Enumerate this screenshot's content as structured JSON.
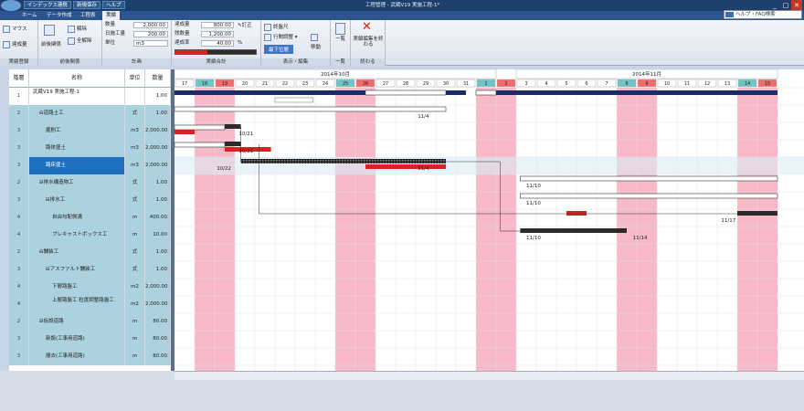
{
  "titlebar": {
    "app_menu": "インデックス連携",
    "quick1": "新規保存",
    "quick2": "ヘルプ",
    "title": "工程管理 - 武蔵V19 実施工程-1*"
  },
  "tabs": [
    "ホーム",
    "データ作成",
    "工程表",
    "実績"
  ],
  "active_tab": "実績",
  "help": {
    "placeholder": "ヘルプ・FAQ検索"
  },
  "ribbon": {
    "g1": {
      "label": "実績登録",
      "mouse": "マウス",
      "input": "達成量"
    },
    "g2": {
      "label": "前後関係",
      "before_after": "前後関係",
      "release": "解除",
      "all_release": "全解除"
    },
    "g3": {
      "label": "計画",
      "qty_label": "数量",
      "qty": "2,000.00",
      "cost_label": "日施工量",
      "cost": "200.00",
      "unit_label": "単位",
      "unit": "m3"
    },
    "g4": {
      "label": "実績合計",
      "done_label": "達成量",
      "done": "800.00",
      "remain_label": "残数量",
      "remain": "1,200.00",
      "rate_label": "達成率",
      "rate": "40.00",
      "pct": "%",
      "fix": "訂正",
      "progress_ratio": 0.4
    },
    "g5": {
      "label": "表示・編集",
      "timeline": "終盤尺",
      "row_adjust": "行間調整",
      "lower_cmd": "最下位層",
      "move": "移動"
    },
    "g6": {
      "label": "一覧",
      "list": "一覧"
    },
    "g7": {
      "label": "終わる",
      "end": "実績編集を終わる"
    }
  },
  "table": {
    "headers": [
      "階層",
      "名称",
      "単位",
      "数量"
    ],
    "rows": [
      {
        "lvl": "1",
        "name": "武蔵V19  実施工程-1",
        "unit": "",
        "qty": "1.00",
        "style": "white",
        "indent": 0
      },
      {
        "lvl": "2",
        "name": "⊟道路土工",
        "unit": "式",
        "qty": "1.00",
        "style": "blue",
        "indent": 1
      },
      {
        "lvl": "3",
        "name": "掘削工",
        "unit": "m3",
        "qty": "2,000.00",
        "style": "blue",
        "indent": 2
      },
      {
        "lvl": "3",
        "name": "路体盛土",
        "unit": "m3",
        "qty": "2,000.00",
        "style": "blue",
        "indent": 2
      },
      {
        "lvl": "3",
        "name": "路床盛土",
        "unit": "m3",
        "qty": "2,000.00",
        "style": "sel",
        "indent": 2
      },
      {
        "lvl": "2",
        "name": "⊟排水構造物工",
        "unit": "式",
        "qty": "1.00",
        "style": "blue",
        "indent": 1
      },
      {
        "lvl": "3",
        "name": "⊟排水工",
        "unit": "式",
        "qty": "1.00",
        "style": "blue",
        "indent": 2
      },
      {
        "lvl": "4",
        "name": "自由勾配側溝",
        "unit": "m",
        "qty": "400.00",
        "style": "blue",
        "indent": 3
      },
      {
        "lvl": "4",
        "name": "プレキャストボックス工",
        "unit": "m",
        "qty": "10.00",
        "style": "blue",
        "indent": 3
      },
      {
        "lvl": "2",
        "name": "⊟舗装工",
        "unit": "式",
        "qty": "1.00",
        "style": "blue",
        "indent": 1
      },
      {
        "lvl": "3",
        "name": "⊟アスファルト舗装工",
        "unit": "式",
        "qty": "1.00",
        "style": "blue",
        "indent": 2
      },
      {
        "lvl": "4",
        "name": "下層路盤工",
        "unit": "m2",
        "qty": "2,000.00",
        "style": "blue",
        "indent": 3
      },
      {
        "lvl": "4",
        "name": "上層路盤工  粒度調整路盤工",
        "unit": "m2",
        "qty": "2,000.00",
        "style": "blue",
        "indent": 3
      },
      {
        "lvl": "2",
        "name": "⊟仮設道路",
        "unit": "m",
        "qty": "80.00",
        "style": "blue",
        "indent": 1
      },
      {
        "lvl": "3",
        "name": "新設(工事用道路)",
        "unit": "m",
        "qty": "80.00",
        "style": "blue",
        "indent": 2
      },
      {
        "lvl": "3",
        "name": "撤去(工事用道路)",
        "unit": "m",
        "qty": "80.00",
        "style": "blue",
        "indent": 2
      }
    ]
  },
  "gantt": {
    "months": [
      {
        "label": "2014年10月",
        "start": 0,
        "end": 16
      },
      {
        "label": "2014年11月",
        "start": 17,
        "end": 31
      }
    ],
    "days": [
      17,
      18,
      19,
      20,
      21,
      22,
      23,
      24,
      25,
      26,
      27,
      28,
      29,
      30,
      31,
      1,
      2,
      3,
      4,
      5,
      6,
      7,
      8,
      9,
      10,
      11,
      12,
      13,
      14,
      15
    ],
    "day_kinds": [
      "n",
      "sat",
      "sun",
      "n",
      "n",
      "n",
      "n",
      "n",
      "sat",
      "sun",
      "n",
      "n",
      "n",
      "n",
      "n",
      "sat",
      "sun",
      "n",
      "n",
      "n",
      "n",
      "n",
      "sat",
      "sun",
      "n",
      "n",
      "n",
      "n",
      "sat",
      "sun"
    ],
    "colors": {
      "weekend": "#f7b8c8",
      "sat_hdr": "#6fc4c4",
      "sun_hdr": "#f26b6b",
      "plan": "#1b2a6b",
      "actual": "#d62424",
      "hatched": "#333333",
      "summary": "#2b2b2b",
      "outline": "#ffffff"
    },
    "labels": [
      {
        "text": "11/4",
        "row": 1,
        "day": 12.1
      },
      {
        "text": "10/21",
        "row": 2,
        "day": 3.2
      },
      {
        "text": "10/21",
        "row": 3,
        "day": 3.2
      },
      {
        "text": "10/22",
        "row": 4,
        "day": 2.1
      },
      {
        "text": "11/4",
        "row": 4,
        "day": 12.1
      },
      {
        "text": "11/10",
        "row": 5,
        "day": 17.5
      },
      {
        "text": "11/10",
        "row": 6,
        "day": 17.5
      },
      {
        "text": "11/17",
        "row": 7,
        "day": 27.2
      },
      {
        "text": "11/10",
        "row": 8,
        "day": 17.5
      },
      {
        "text": "11/14",
        "row": 8,
        "day": 22.8
      }
    ],
    "bars": [
      {
        "row": 0,
        "start": 0,
        "end": 9.5,
        "kind": "plan"
      },
      {
        "row": 0,
        "start": 9.5,
        "end": 13.5,
        "kind": "plan_out"
      },
      {
        "row": 0,
        "start": 13.5,
        "end": 14.5,
        "kind": "plan"
      },
      {
        "row": 0,
        "start": 15,
        "end": 16,
        "kind": "plan_out"
      },
      {
        "row": 0,
        "start": 16,
        "end": 30,
        "kind": "plan"
      },
      {
        "row": 1,
        "start": 0,
        "end": 13.5,
        "kind": "outline"
      },
      {
        "row": 1,
        "start": 5,
        "end": 6.9,
        "kind": "green_small"
      },
      {
        "row": 2,
        "start": 0,
        "end": 2.5,
        "kind": "plan_out"
      },
      {
        "row": 2,
        "start": 2.5,
        "end": 3.3,
        "kind": "summary"
      },
      {
        "row": 3,
        "start": 0,
        "end": 2.5,
        "kind": "plan_out"
      },
      {
        "row": 3,
        "start": 2.5,
        "end": 3.3,
        "kind": "summary_short"
      },
      {
        "row": 4,
        "start": 3.3,
        "end": 13.5,
        "kind": "hatched"
      },
      {
        "row": 5,
        "start": 17.2,
        "end": 30,
        "kind": "outline"
      },
      {
        "row": 6,
        "start": 17.2,
        "end": 30,
        "kind": "outline"
      },
      {
        "row": 7,
        "start": 28,
        "end": 30,
        "kind": "summary"
      },
      {
        "row": 8,
        "start": 17.2,
        "end": 22.5,
        "kind": "summary"
      }
    ]
  }
}
